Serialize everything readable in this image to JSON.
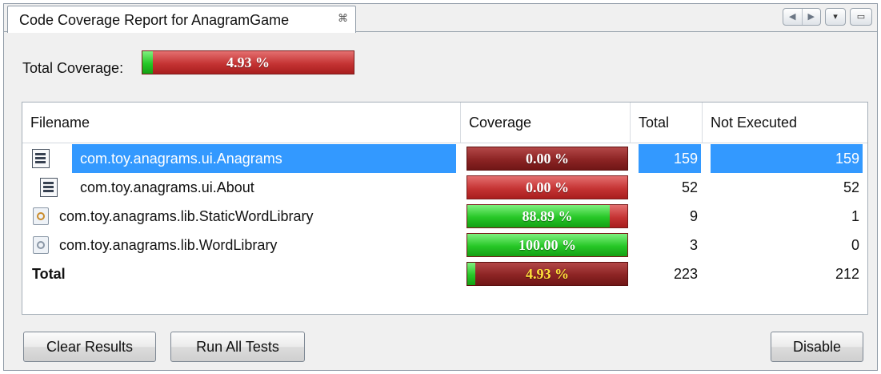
{
  "tab": {
    "title": "Code Coverage Report for AnagramGame",
    "close_glyph": "⌘"
  },
  "window_controls": {
    "prev": "◀",
    "next": "▶",
    "menu": "▾",
    "maximize": "▭"
  },
  "summary": {
    "label": "Total Coverage:",
    "value_text": "4.93 %",
    "value": 4.93
  },
  "table": {
    "headers": {
      "filename": "Filename",
      "coverage": "Coverage",
      "total": "Total",
      "not_executed": "Not Executed"
    },
    "rows": [
      {
        "filename": "com.toy.anagrams.ui.Anagrams",
        "coverage_text": "0.00 %",
        "coverage": 0.0,
        "total": "159",
        "not_executed": "159",
        "selected": true,
        "icon": "form-file-icon"
      },
      {
        "filename": "com.toy.anagrams.ui.About",
        "coverage_text": "0.00 %",
        "coverage": 0.0,
        "total": "52",
        "not_executed": "52",
        "selected": false,
        "icon": "form-file-icon"
      },
      {
        "filename": "com.toy.anagrams.lib.StaticWordLibrary",
        "coverage_text": "88.89 %",
        "coverage": 88.89,
        "total": "9",
        "not_executed": "1",
        "selected": false,
        "icon": "java-class-icon"
      },
      {
        "filename": "com.toy.anagrams.lib.WordLibrary",
        "coverage_text": "100.00 %",
        "coverage": 100.0,
        "total": "3",
        "not_executed": "0",
        "selected": false,
        "icon": "java-class-icon"
      }
    ],
    "total_row": {
      "label": "Total",
      "coverage_text": "4.93 %",
      "coverage": 4.93,
      "total": "223",
      "not_executed": "212"
    }
  },
  "buttons": {
    "clear": "Clear Results",
    "run_all": "Run All Tests",
    "disable": "Disable"
  },
  "colors": {
    "selection": "#3399ff",
    "covered": "#27c727",
    "uncovered": "#c53434"
  }
}
